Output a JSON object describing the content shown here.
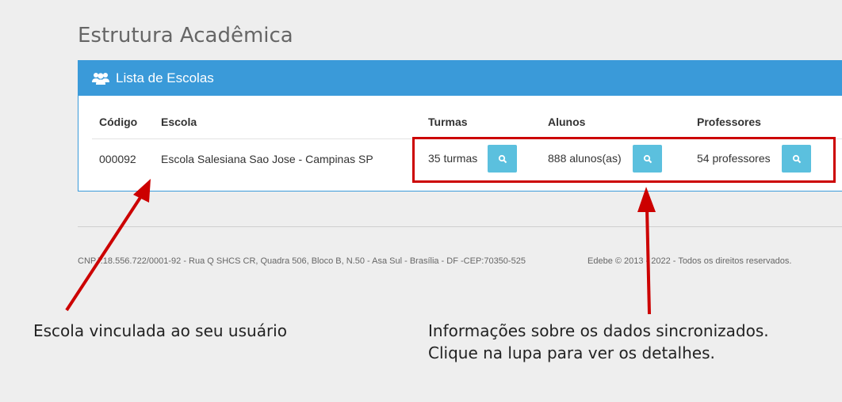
{
  "page": {
    "title": "Estrutura Acadêmica"
  },
  "panel": {
    "title": "Lista de Escolas",
    "icon": "users-icon"
  },
  "table": {
    "headers": {
      "codigo": "Código",
      "escola": "Escola",
      "turmas": "Turmas",
      "alunos": "Alunos",
      "professores": "Professores"
    },
    "rows": [
      {
        "codigo": "000092",
        "escola": "Escola Salesiana Sao Jose - Campinas SP",
        "turmas": "35 turmas",
        "alunos": "888 alunos(as)",
        "professores": "54 professores"
      }
    ],
    "detail_icon": "search-icon"
  },
  "footer": {
    "address": "CNPJ:18.556.722/0001-92 - Rua Q SHCS CR, Quadra 506, Bloco B, N.50 - Asa Sul - Brasília - DF -CEP:70350-525",
    "copyright": "Edebe © 2013 - 2022 - Todos os direitos reservados."
  },
  "annotations": {
    "school": "Escola vinculada ao seu usuário",
    "info_line1": "Informações sobre os dados sincronizados.",
    "info_line2": "Clique na lupa para ver os detalhes."
  },
  "colors": {
    "header_blue": "#3a9ad9",
    "button_cyan": "#5bc0de",
    "annotation_red": "#cc0000"
  }
}
